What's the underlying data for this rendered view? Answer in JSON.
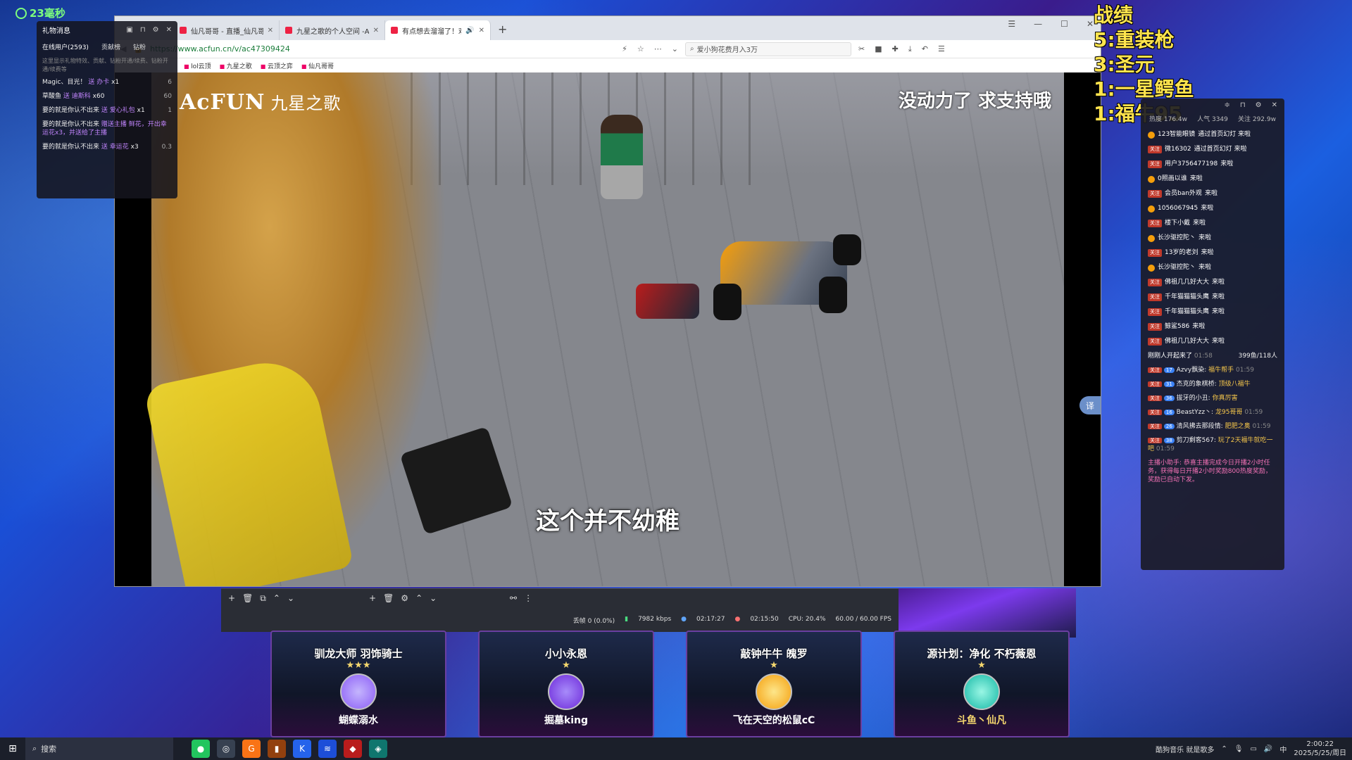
{
  "ping": "23毫秒",
  "gift_panel": {
    "title": "礼物消息",
    "tabs": [
      "在线用户(2593)",
      "贡献榜",
      "钻粉"
    ],
    "note": "这里显示礼物特效、贡献、钻粉开通/续费、钻粉开通/续费等",
    "rows": [
      {
        "user": "Magic、目光！",
        "action": "送 办卡",
        "count": "x1",
        "amount": "6"
      },
      {
        "user": "草酸鱼",
        "action": "送 迪斯科",
        "count": "x60",
        "amount": "60"
      },
      {
        "user": "要的就是你认不出来",
        "action": "送 爱心礼包",
        "count": "x1",
        "amount": "1"
      },
      {
        "user": "要的就是你认不出来",
        "action": "赠送主播 鲜花，开出幸运花x3，并送给了主播",
        "count": "",
        "amount": ""
      },
      {
        "user": "要的就是你认不出来",
        "action": "送 幸运花",
        "count": "x3",
        "amount": "0.3"
      }
    ]
  },
  "browser": {
    "tabs": [
      {
        "title": "仙凡哥哥 - 直播_仙凡哥哥 - 直",
        "active": false
      },
      {
        "title": "九星之歌的个人空间 -AcFun弹",
        "active": false
      },
      {
        "title": "有点想去溜溜了！欢乐八分",
        "active": true
      }
    ],
    "new_tab": "+",
    "url": "https://www.acfun.cn/v/ac47309424",
    "search_placeholder": "爱小狗花费月入3万",
    "bookmarks": [
      "lol云顶",
      "九星之歌",
      "云顶之弈",
      "仙凡哥哥"
    ]
  },
  "video": {
    "logo": "AcFUN",
    "channel": "九星之歌",
    "top_caption": "没动力了 求支持哦",
    "subtitle": "这个并不幼稚",
    "float_button": "译"
  },
  "stats_overlay": [
    "战绩",
    "5:重装枪",
    "3:圣元",
    "1:一星鳄鱼",
    "1:福牛95"
  ],
  "danmu": {
    "heat": "热度 176.4w",
    "popularity": "人气 3349",
    "follows": "关注 292.9w",
    "entries": [
      {
        "badge": "o",
        "user": "123智能眼镜",
        "text": "通过首页幻灯 来啦"
      },
      {
        "badge": "r",
        "user": "微16302",
        "text": "通过首页幻灯 来啦"
      },
      {
        "badge": "r",
        "user": "用户3756477198",
        "text": "来啦"
      },
      {
        "badge": "o",
        "user": "0照画以谁",
        "text": "来啦"
      },
      {
        "badge": "r",
        "user": "会员ban外观",
        "text": "来啦"
      },
      {
        "badge": "o",
        "user": "1056067945",
        "text": "来啦"
      },
      {
        "badge": "r",
        "user": "楼下小戴",
        "text": "来啦"
      },
      {
        "badge": "o",
        "user": "长沙驱控陀丶",
        "text": "来啦"
      },
      {
        "badge": "r",
        "user": "13岁的老刘",
        "text": "来啦"
      },
      {
        "badge": "o",
        "user": "长沙驱控陀丶",
        "text": "来啦"
      },
      {
        "badge": "r",
        "user": "佛祖几几好大大",
        "text": "来啦"
      },
      {
        "badge": "r",
        "user": "千年猫猫猫头鹰",
        "text": "来啦"
      },
      {
        "badge": "r",
        "user": "千年猫猫猫头鹰",
        "text": "来啦"
      },
      {
        "badge": "r",
        "user": "鲸鲨586",
        "text": "来啦"
      },
      {
        "badge": "r",
        "user": "佛祖几几好大大",
        "text": "来啦"
      }
    ],
    "summary_left": "刚刚人开起来了",
    "summary_time": "01:58",
    "summary_right": "399鱼/118人",
    "comments": [
      {
        "lv": "17",
        "user": "Azvy飘染:",
        "text": "福牛帮手",
        "time": "01:59"
      },
      {
        "lv": "31",
        "user": "杰克的象棋桥:",
        "text": "顶级八福牛",
        "time": ""
      },
      {
        "lv": "36",
        "user": "拔牙的小丑:",
        "text": "你真厉害",
        "time": ""
      },
      {
        "lv": "16",
        "user": "BeastYzz丶:",
        "text": "龙95哥哥",
        "time": "01:59"
      },
      {
        "lv": "26",
        "user": "清风拂去那段情:",
        "text": "肥肥之奥",
        "time": "01:59"
      },
      {
        "lv": "38",
        "user": "剪刀剩客567:",
        "text": "玩了2天福牛就吃一吧",
        "time": "01:59"
      }
    ],
    "notice": "主播小助手: 恭喜主播完成今日开播2小时任务，获得每日开播2小时奖励800热度奖励，奖励已自动下发。"
  },
  "obs": {
    "dropped": "丢帧 0 (0.0%)",
    "bitrate": "7982 kbps",
    "stream_time": "02:17:27",
    "rec_time": "02:15:50",
    "cpu": "CPU: 20.4%",
    "fps": "60.00 / 60.00 FPS"
  },
  "cards": [
    {
      "name": "驯龙大师 羽饰骑士",
      "stars": "★★★",
      "player": "蝴蝶溺水",
      "avatar": "#8b5cf6",
      "gold": false
    },
    {
      "name": "小小永恩",
      "stars": "★",
      "player": "掘墓king",
      "avatar": "#6d28d9",
      "gold": false
    },
    {
      "name": "敲钟牛牛 魄罗",
      "stars": "★",
      "player": "飞在天空的松鼠cC",
      "avatar": "#f59e0b",
      "gold": false
    },
    {
      "name": "源计划：净化 不朽薇恩",
      "stars": "★",
      "player": "斗鱼丶仙凡",
      "avatar": "#14b8a6",
      "gold": true
    }
  ],
  "taskbar": {
    "search": "搜索",
    "tray_text": "酷狗音乐 就是歌多",
    "ime": "中",
    "time": "2:00:22",
    "date": "2025/5/25/周日"
  }
}
